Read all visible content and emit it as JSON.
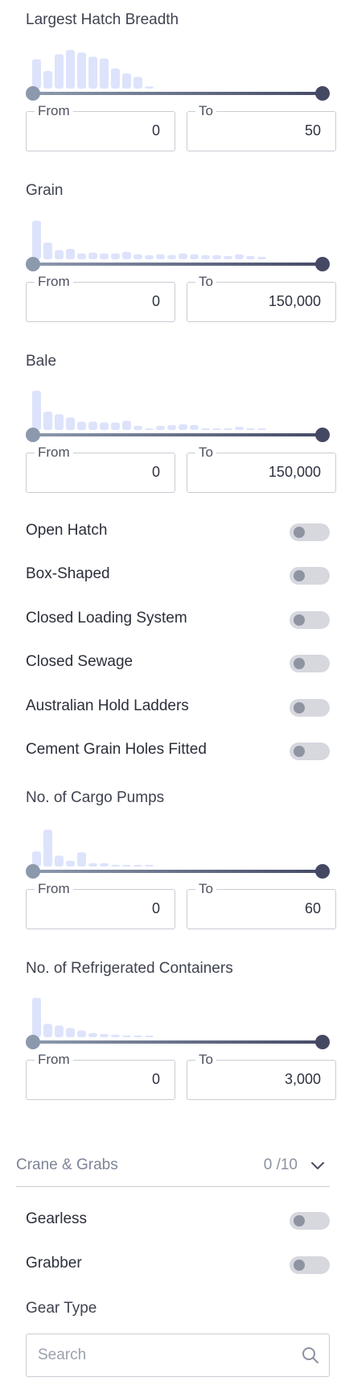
{
  "ranges": [
    {
      "id": "hatch-breadth",
      "title": "Largest Hatch Breadth",
      "from_label": "From",
      "to_label": "To",
      "from_value": "0",
      "to_value": "50",
      "histogram": [
        0.7,
        0.42,
        0.82,
        0.92,
        0.86,
        0.76,
        0.72,
        0.48,
        0.36,
        0.28,
        0.05
      ]
    },
    {
      "id": "grain",
      "title": "Grain",
      "from_label": "From",
      "to_label": "To",
      "from_value": "0",
      "to_value": "150,000",
      "histogram": [
        0.92,
        0.4,
        0.22,
        0.25,
        0.14,
        0.16,
        0.14,
        0.14,
        0.18,
        0.12,
        0.1,
        0.12,
        0.1,
        0.14,
        0.12,
        0.1,
        0.1,
        0.08,
        0.12,
        0.08,
        0.06
      ]
    },
    {
      "id": "bale",
      "title": "Bale",
      "from_label": "From",
      "to_label": "To",
      "from_value": "0",
      "to_value": "150,000",
      "histogram": [
        0.94,
        0.44,
        0.38,
        0.3,
        0.2,
        0.2,
        0.18,
        0.18,
        0.22,
        0.1,
        0.04,
        0.1,
        0.12,
        0.14,
        0.12,
        0.04,
        0.04,
        0.04,
        0.08,
        0.04,
        0.04
      ]
    },
    {
      "id": "cargo-pumps",
      "title": "No. of Cargo Pumps",
      "from_label": "From",
      "to_label": "To",
      "from_value": "0",
      "to_value": "60",
      "histogram": [
        0.36,
        0.88,
        0.26,
        0.14,
        0.34,
        0.08,
        0.08,
        0.04,
        0.04,
        0.02,
        0.02
      ]
    },
    {
      "id": "reefer-containers",
      "title": "No. of Refrigerated Containers",
      "from_label": "From",
      "to_label": "To",
      "from_value": "0",
      "to_value": "3,000",
      "histogram": [
        0.94,
        0.32,
        0.28,
        0.22,
        0.16,
        0.1,
        0.08,
        0.06,
        0.04,
        0.04,
        0.02
      ]
    }
  ],
  "toggles_group1": [
    {
      "id": "open-hatch",
      "label": "Open Hatch",
      "on": false
    },
    {
      "id": "box-shaped",
      "label": "Box-Shaped",
      "on": false
    },
    {
      "id": "closed-loading-system",
      "label": "Closed Loading System",
      "on": false
    },
    {
      "id": "closed-sewage",
      "label": "Closed Sewage",
      "on": false
    },
    {
      "id": "australian-hold-ladders",
      "label": "Australian Hold Ladders",
      "on": false
    },
    {
      "id": "cement-grain-holes",
      "label": "Cement Grain Holes Fitted",
      "on": false
    }
  ],
  "crane_section": {
    "title": "Crane & Grabs",
    "count": "0 /10"
  },
  "toggles_group2": [
    {
      "id": "gearless",
      "label": "Gearless",
      "on": false
    },
    {
      "id": "grabber",
      "label": "Grabber",
      "on": false
    }
  ],
  "gear_type": {
    "title": "Gear Type",
    "placeholder": "Search"
  },
  "colors": {
    "histogram_bar": "#dde3fb",
    "slider_start": "#8c99ad",
    "slider_end": "#444862",
    "toggle_off": "#d7d8de"
  }
}
